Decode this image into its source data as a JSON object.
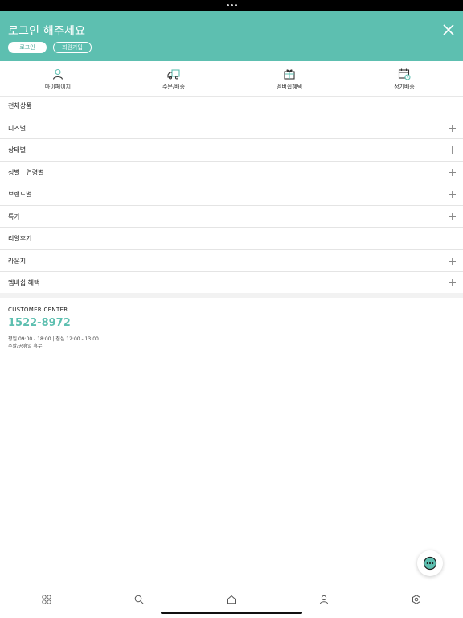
{
  "header": {
    "title": "로그인 해주세요",
    "login_label": "로그인",
    "signup_label": "회원가입"
  },
  "quick_links": [
    {
      "label": "마이페이지",
      "icon": "person-icon"
    },
    {
      "label": "주문/배송",
      "icon": "delivery-truck-icon"
    },
    {
      "label": "멤버쉽혜택",
      "icon": "gift-box-icon"
    },
    {
      "label": "정기배송",
      "icon": "calendar-clock-icon"
    }
  ],
  "menu": [
    {
      "label": "전체상품",
      "expandable": false
    },
    {
      "label": "니즈별",
      "expandable": true
    },
    {
      "label": "상태별",
      "expandable": true
    },
    {
      "label": "성별 · 연령별",
      "expandable": true
    },
    {
      "label": "브랜드별",
      "expandable": true
    },
    {
      "label": "특가",
      "expandable": true
    },
    {
      "label": "리얼후기",
      "expandable": false
    },
    {
      "label": "라운지",
      "expandable": true
    },
    {
      "label": "멤버쉽 혜택",
      "expandable": true
    }
  ],
  "customer_center": {
    "title": "CUSTOMER CENTER",
    "phone": "1522-8972",
    "hours": "평일 09:00 - 18:00 | 점심 12:00 - 13:00",
    "holiday": "주말/공휴일 휴무"
  },
  "tabbar": [
    "grid-icon",
    "search-icon",
    "home-icon",
    "user-icon",
    "settings-icon"
  ],
  "colors": {
    "accent": "#5dbfb0"
  }
}
